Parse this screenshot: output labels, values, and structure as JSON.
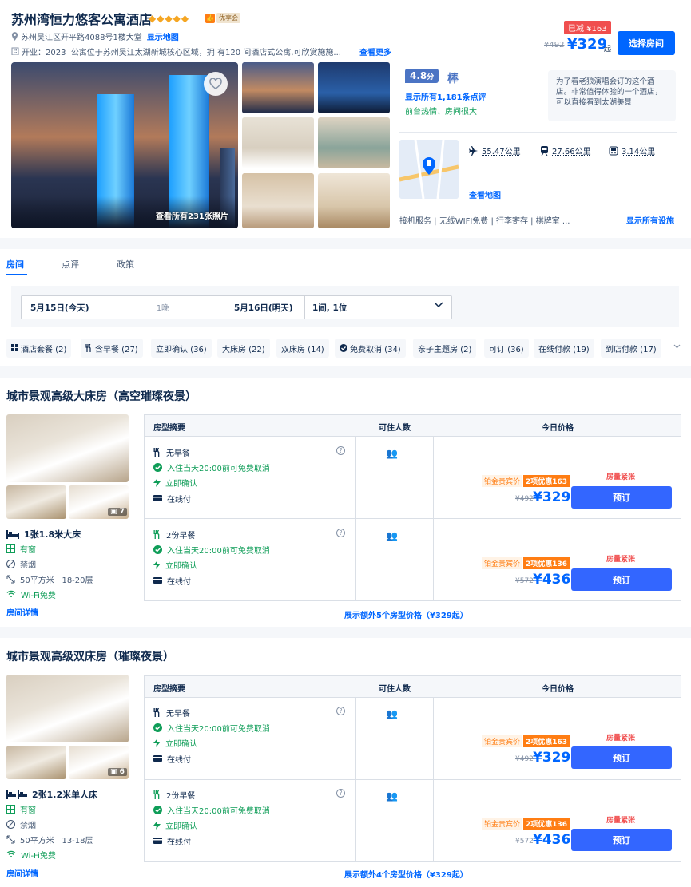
{
  "hotel": {
    "name": "苏州湾恒力悠客公寓酒店",
    "stars": "◆◆◆◆◆",
    "badge": "优享会",
    "address": "苏州吴江区开平路4088号1楼大堂",
    "map_link": "显示地图",
    "opening": "开业：2023",
    "description": "公寓位于苏州吴江太湖新城核心区域，拥 有120 间酒店式公寓,可欣赏施施...",
    "more_link": "查看更多"
  },
  "header_price": {
    "discount": "已减 ¥163",
    "original": "¥492",
    "current": "¥329",
    "suffix": "起",
    "choose_btn": "选择房间"
  },
  "gallery": {
    "photo_count": "查看所有231张照片"
  },
  "rating": {
    "score": "4.8",
    "score_unit": "分",
    "label": "棒",
    "reviews": "显示所有1,181条点评",
    "tags": "前台热情、房间很大",
    "quote": "为了看老狼演唱会订的这个酒店。非常值得体验的一个酒店，可以直接看到太湖美景"
  },
  "distances": [
    {
      "icon": "plane-icon",
      "value": "55.47公里"
    },
    {
      "icon": "train-icon",
      "value": "27.66公里"
    },
    {
      "icon": "metro-icon",
      "value": "3.14公里"
    }
  ],
  "map": {
    "link": "查看地图"
  },
  "facilities": {
    "text": "接机服务 | 无线WIFI免费 | 行李寄存 | 棋牌室 ...",
    "all_link": "显示所有设施"
  },
  "tabs": [
    "房间",
    "点评",
    "政策"
  ],
  "search": {
    "checkin": "5月15日(今天)",
    "nights": "1晚",
    "checkout": "5月16日(明天)",
    "guests": "1间, 1位"
  },
  "filters": [
    {
      "icon": "package-icon",
      "label": "酒店套餐 (2)"
    },
    {
      "icon": "cutlery-icon",
      "label": "含早餐 (27)"
    },
    {
      "icon": "",
      "label": "立即确认 (36)"
    },
    {
      "icon": "",
      "label": "大床房 (22)"
    },
    {
      "icon": "",
      "label": "双床房 (14)"
    },
    {
      "icon": "check-circle-icon",
      "label": "免费取消 (34)"
    },
    {
      "icon": "",
      "label": "亲子主题房 (2)"
    },
    {
      "icon": "",
      "label": "可订 (36)"
    },
    {
      "icon": "",
      "label": "在线付款 (19)"
    },
    {
      "icon": "",
      "label": "到店付款 (17)"
    }
  ],
  "table_headers": {
    "summary": "房型摘要",
    "occupancy": "可住人数",
    "price": "今日价格"
  },
  "rooms": [
    {
      "title": "城市景观高级大床房（高空璀璨夜景）",
      "img_count": "7",
      "bed": "1张1.8米大床",
      "window": "有窗",
      "smoke": "禁烟",
      "area": "50平方米 | 18-20层",
      "wifi": "Wi-Fi免费",
      "detail_link": "房间详情",
      "more_link": "展示额外5个房型价格（¥329起）",
      "offers": [
        {
          "breakfast": "无早餐",
          "cancel": "入住当天20:00前可免费取消",
          "confirm": "立即确认",
          "pay": "在线付",
          "vip": "铂金贵宾价",
          "promo": "2项优惠163",
          "urgent": "房量紧张",
          "old": "¥492",
          "price": "¥329",
          "book": "预订"
        },
        {
          "breakfast": "2份早餐",
          "cancel": "入住当天20:00前可免费取消",
          "confirm": "立即确认",
          "pay": "在线付",
          "vip": "铂金贵宾价",
          "promo": "2项优惠136",
          "urgent": "房量紧张",
          "old": "¥572",
          "price": "¥436",
          "book": "预订"
        }
      ]
    },
    {
      "title": "城市景观高级双床房（璀璨夜景）",
      "img_count": "6",
      "bed": "2张1.2米单人床",
      "window": "有窗",
      "smoke": "禁烟",
      "area": "50平方米 | 13-18层",
      "wifi": "Wi-Fi免费",
      "detail_link": "房间详情",
      "more_link": "展示额外4个房型价格（¥329起）",
      "offers": [
        {
          "breakfast": "无早餐",
          "cancel": "入住当天20:00前可免费取消",
          "confirm": "立即确认",
          "pay": "在线付",
          "vip": "铂金贵宾价",
          "promo": "2项优惠163",
          "urgent": "房量紧张",
          "old": "¥492",
          "price": "¥329",
          "book": "预订"
        },
        {
          "breakfast": "2份早餐",
          "cancel": "入住当天20:00前可免费取消",
          "confirm": "立即确认",
          "pay": "在线付",
          "vip": "铂金贵宾价",
          "promo": "2项优惠136",
          "urgent": "房量紧张",
          "old": "¥572",
          "price": "¥436",
          "book": "预订"
        }
      ]
    }
  ],
  "colors": {
    "primary": "#0066ff",
    "accent_orange": "#ff7d13",
    "green": "#0f9d58",
    "red": "#f04e4e"
  }
}
